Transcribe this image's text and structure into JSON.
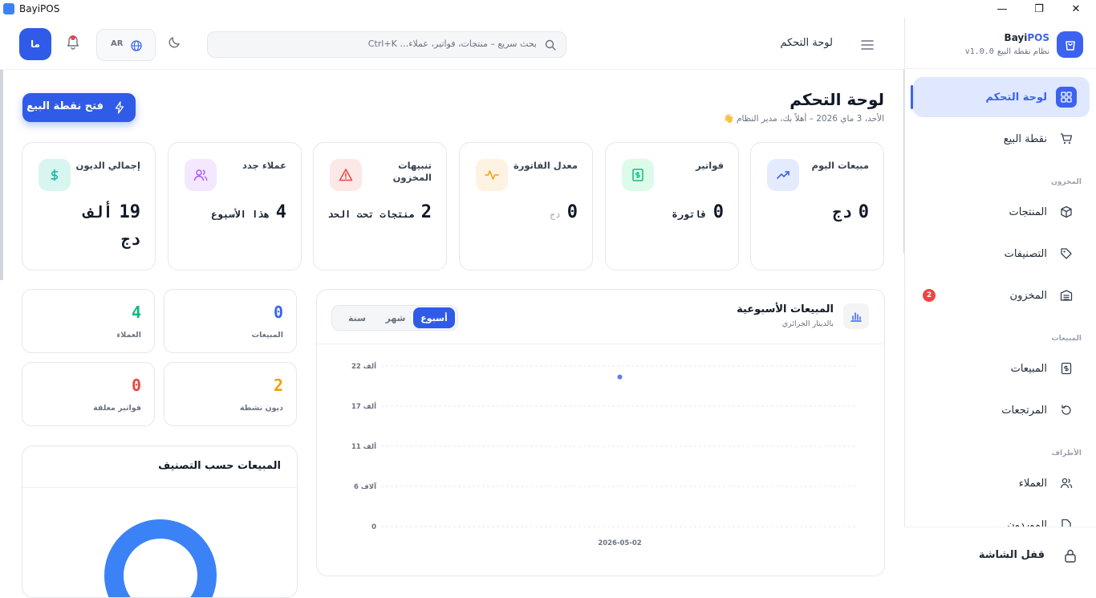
{
  "window": {
    "title": "BayiPOS",
    "minimize": "—",
    "restore": "❐",
    "close": "✕"
  },
  "header": {
    "title": "لوحة التحكم",
    "search_placeholder": "بحث سريع – منتجات، فواتير، عملاء… Ctrl+K",
    "language": "AR",
    "avatar_initials": "ما"
  },
  "brand": {
    "name_part1": "Bayi",
    "name_part2": "POS",
    "subtitle": "نظام نقطة البيع",
    "version": "v1.0.0"
  },
  "sidebar": {
    "items": [
      {
        "label": "لوحة التحكم",
        "icon": "grid-icon",
        "active": true
      },
      {
        "label": "نقطة البيع",
        "icon": "cart-icon"
      },
      {
        "label": "المنتجات",
        "icon": "box-icon"
      },
      {
        "label": "التصنيفات",
        "icon": "tag-icon"
      },
      {
        "label": "المخزون",
        "icon": "warehouse-icon",
        "badge": "2"
      },
      {
        "label": "المبيعات",
        "icon": "receipt-icon"
      },
      {
        "label": "المرتجعات",
        "icon": "undo-icon"
      },
      {
        "label": "العملاء",
        "icon": "users-icon"
      },
      {
        "label": "الموردون",
        "icon": "file-icon"
      }
    ],
    "sections": {
      "inventory": "المخزون",
      "sales": "المبيعات",
      "parties": "الأطراف"
    },
    "lock_label": "قفل الشاشة"
  },
  "page": {
    "title": "لوحة التحكم",
    "subtitle": "الأحد، 3 ماي 2026 – أهلاً بك، مدير النظام 👋",
    "pos_button": "فتح نقطة البيع"
  },
  "stats": [
    {
      "title": "مبيعات اليوم",
      "value": "0",
      "unit": "دج",
      "icon": "trending-up-icon",
      "color": "#3b63f0"
    },
    {
      "title": "فواتير",
      "value": "0",
      "unit": "فاتورة",
      "icon": "dollar-doc-icon",
      "color": "#10b981"
    },
    {
      "title": "معدل الفاتورة",
      "value": "0",
      "unit": "دج",
      "icon": "activity-icon",
      "color": "#f59e0b"
    },
    {
      "title": "تنبيهات المخزون",
      "value": "2",
      "unit": "منتجات تحت الحد",
      "icon": "alert-triangle-icon",
      "color": "#ef4444"
    },
    {
      "title": "عملاء جدد",
      "value": "4",
      "unit": "هذا الأسبوع",
      "icon": "users-icon",
      "color": "#a855f7"
    },
    {
      "title": "إجمالي الديون",
      "value": "19",
      "unit": "ألف",
      "unit2": "دج",
      "icon": "dollar-icon",
      "color": "#14b8a6"
    }
  ],
  "mini_stats": [
    {
      "value": "0",
      "label": "المبيعات",
      "color": "#3b63f0"
    },
    {
      "value": "4",
      "label": "العملاء",
      "color": "#10b981"
    },
    {
      "value": "2",
      "label": "ديون نشطة",
      "color": "#f59e0b"
    },
    {
      "value": "0",
      "label": "فواتير معلقة",
      "color": "#ef4444"
    }
  ],
  "weekly_chart": {
    "title": "المبيعات الأسبوعية",
    "subtitle": "بالدينار الجزائري",
    "tabs": [
      "أسبوع",
      "شهر",
      "سنة"
    ],
    "active_tab": "أسبوع"
  },
  "category_chart": {
    "title": "المبيعات حسب التصنيف"
  },
  "chart_data": [
    {
      "type": "line",
      "title": "المبيعات الأسبوعية",
      "x": [
        "2026-05-02"
      ],
      "series": [
        {
          "values": [
            20500
          ],
          "color": "#5b7cf0"
        }
      ],
      "yticks": [
        0,
        5500,
        11000,
        16500,
        22000
      ],
      "ytick_labels": [
        "0",
        "6 آلاف",
        "11 ألف",
        "17 ألف",
        "22 ألف"
      ],
      "ylim": [
        0,
        22000
      ],
      "grid": true
    },
    {
      "type": "pie",
      "title": "المبيعات حسب التصنيف",
      "slices": [
        {
          "value": 96,
          "color": "#3b82f6"
        },
        {
          "value": 2,
          "color": "#ef4444"
        },
        {
          "value": 2,
          "color": "#6366f1"
        }
      ]
    }
  ]
}
